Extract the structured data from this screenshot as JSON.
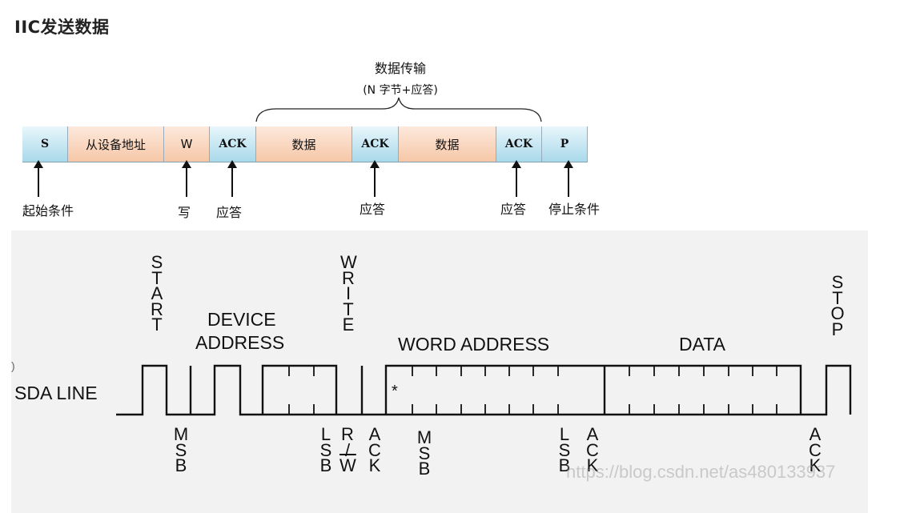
{
  "heading": "IIC发送数据",
  "top": {
    "brace_title": "数据传输",
    "brace_sub": "(N 字节+应答)",
    "segments": [
      "S",
      "从设备地址",
      "W",
      "ACK",
      "数据",
      "ACK",
      "数据",
      "ACK",
      "P"
    ],
    "labels": {
      "start": "起始条件",
      "write": "写",
      "ack1": "应答",
      "ack2": "应答",
      "ack3": "应答",
      "stop": "停止条件"
    }
  },
  "bottom": {
    "start": "START",
    "device_address_1": "DEVICE",
    "device_address_2": "ADDRESS",
    "write": "WRITE",
    "word_address": "WORD ADDRESS",
    "data": "DATA",
    "stop": "STOP",
    "sda_line": "SDA LINE",
    "star": "*",
    "msb1": "MSB",
    "lsb1": "LSB",
    "rw_r": "R",
    "rw_slash": "/",
    "rw_w": "W",
    "ack1": "ACK",
    "msb2": "MSB",
    "lsb2": "LSB",
    "ack2": "ACK",
    "ack3": "ACK",
    "left_mark": ")"
  },
  "watermark": "https://blog.csdn.net/as480133937",
  "colors": {
    "blue_segment": "#a9d9ea",
    "orange_segment": "#f6c7a7",
    "panel_bg": "#f2f2f2"
  }
}
